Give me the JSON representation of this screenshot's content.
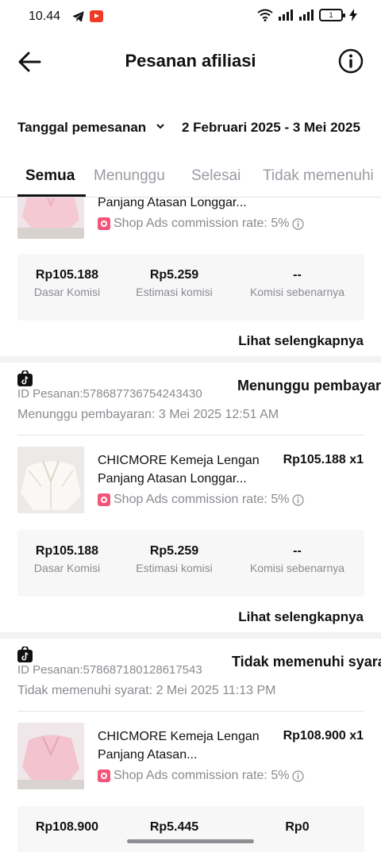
{
  "status_bar": {
    "time": "10.44",
    "battery": "1",
    "icons": [
      "telegram-icon",
      "youtube-icon",
      "wifi-icon",
      "signal-icon",
      "signal-icon",
      "battery-icon",
      "charging-icon"
    ]
  },
  "header": {
    "title": "Pesanan afiliasi",
    "back_icon": "arrow-left-icon",
    "info_icon": "info-icon"
  },
  "filter": {
    "date_type": "Tanggal pemesanan",
    "date_range": "2 Februari 2025 - 3 Mei 2025"
  },
  "tabs": [
    {
      "label": "Semua",
      "active": true
    },
    {
      "label": "Menunggu",
      "active": false
    },
    {
      "label": "Selesai",
      "active": false
    },
    {
      "label": "Tidak memenuhi",
      "active": false
    }
  ],
  "orders": [
    {
      "product_name": "Panjang Atasan Longgar...",
      "commission_rate": "Shop Ads commission rate: 5%",
      "stats": [
        {
          "value": "Rp105.188",
          "label": "Dasar Komisi"
        },
        {
          "value": "Rp5.259",
          "label": "Estimasi komisi"
        },
        {
          "value": "--",
          "label": "Komisi sebenarnya"
        }
      ],
      "see_more": "Lihat selengkapnya"
    },
    {
      "order_id": "ID Pesanan:578687736754243430",
      "status": "Menunggu pembayaran",
      "sub_status": "Menunggu pembayaran: 3 Mei 2025 12:51 AM",
      "product_name": "CHICMORE Kemeja Lengan Panjang Atasan Longgar...",
      "price": "Rp105.188 x1",
      "commission_rate": "Shop Ads commission rate: 5%",
      "stats": [
        {
          "value": "Rp105.188",
          "label": "Dasar Komisi"
        },
        {
          "value": "Rp5.259",
          "label": "Estimasi komisi"
        },
        {
          "value": "--",
          "label": "Komisi sebenarnya"
        }
      ],
      "see_more": "Lihat selengkapnya"
    },
    {
      "order_id": "ID Pesanan:578687180128617543",
      "status": "Tidak memenuhi syarat",
      "sub_status": "Tidak memenuhi syarat: 2 Mei 2025 11:13 PM",
      "product_name": "CHICMORE Kemeja Lengan Panjang Atasan...",
      "price": "Rp108.900 x1",
      "commission_rate": "Shop Ads commission rate: 5%",
      "stats": [
        {
          "value": "Rp108.900",
          "label": ""
        },
        {
          "value": "Rp5.445",
          "label": ""
        },
        {
          "value": "Rp0",
          "label": ""
        }
      ]
    }
  ],
  "colors": {
    "text_primary": "#111111",
    "text_secondary": "#8a8b91",
    "ads_badge": "#f2557a",
    "stats_background": "#f7f7f8"
  }
}
